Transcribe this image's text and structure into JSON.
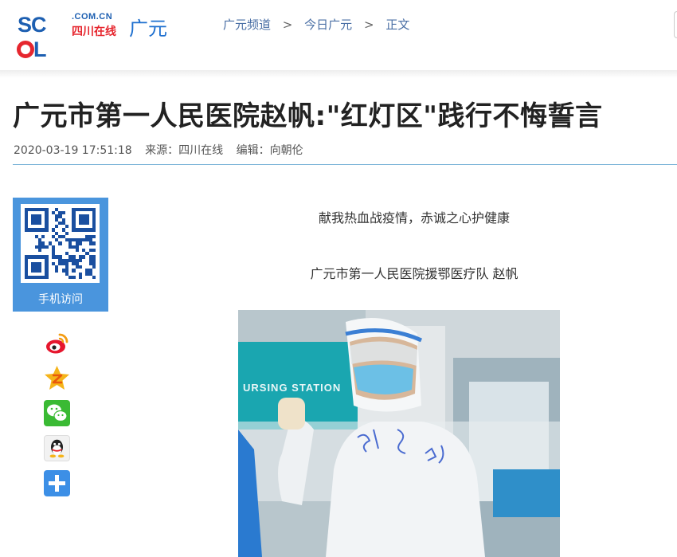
{
  "header": {
    "logo": {
      "domain": ".COM.CN",
      "cn_name": "四川在线",
      "city": "广元"
    },
    "breadcrumb": [
      "广元频道",
      "今日广元",
      "正文"
    ],
    "breadcrumb_separator": ">"
  },
  "article": {
    "title": "广元市第一人民医院赵帆:\"红灯区\"践行不悔誓言",
    "datetime": "2020-03-19 17:51:18",
    "source": "来源：四川在线",
    "editor": "编辑：向朝伦",
    "paragraphs": [
      "献我热血战疫情，赤诚之心护健康",
      "广元市第一人民医院援鄂医疗队 赵帆"
    ],
    "photo": {
      "sign_text": "URSING STATION"
    }
  },
  "share": {
    "mobile_label": "手机访问",
    "icons": [
      "weibo-icon",
      "qzone-icon",
      "wechat-icon",
      "qq-icon",
      "more-share-icon"
    ]
  },
  "colors": {
    "brand_blue": "#1d5fb1",
    "brand_red": "#e6262e",
    "qr_panel": "#4a95dd",
    "rule": "#7ab3d8"
  }
}
